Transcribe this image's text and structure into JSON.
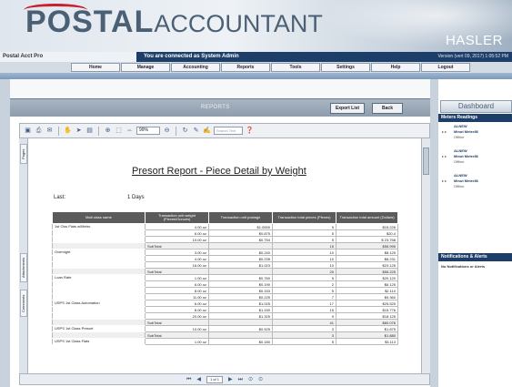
{
  "header": {
    "logo_postal": "POSTAL",
    "logo_accountant": "ACCOUNTANT",
    "brand": "HASLER"
  },
  "infobar": {
    "product_name": "Postal Acct Pro",
    "connected_msg": "You are connected as System Admin",
    "date_status": "Version (vert 09, 2017) 1:05:52 PM"
  },
  "nav": {
    "items": [
      "Home",
      "Manage",
      "Accounting",
      "Reports",
      "Tools",
      "Settings",
      "Help",
      "Logout"
    ]
  },
  "report_bar": {
    "title": "REPORTS",
    "export_label": "Export List",
    "back_label": "Back"
  },
  "toolbar": {
    "zoom": "99%",
    "search_placeholder": "Search Text"
  },
  "side_tabs": {
    "pages": "Pages",
    "attachments": "Attachments",
    "comments": "Comments"
  },
  "report": {
    "title": "Presort Report - Piece Detail by Weight",
    "last_label": "Last:",
    "last_value": "1 Days",
    "columns": [
      "Mail class name",
      "Transaction unit weight (Pieces/Ounces)",
      "Transaction unit postage",
      "Transaction total pieces (Pieces)",
      "Transaction total amount (Dollars)"
    ],
    "groups": [
      {
        "name": "1st Clss Flats w/Metro",
        "rows": [
          {
            "weight": "4.00 oz",
            "unit": "$1.0000",
            "pieces": "5",
            "amount": "$15.226"
          },
          {
            "weight": "6.00 oz",
            "unit": "$0.875",
            "pieces": "5",
            "amount": "$20.4"
          },
          {
            "weight": "10.00 oz",
            "unit": "$0.754",
            "pieces": "5",
            "amount": "$ 23.758"
          }
        ],
        "subtotal_pieces": "15",
        "subtotal_amount": "$55.995"
      },
      {
        "name": "Overnight",
        "rows": [
          {
            "weight": "3.00 oz",
            "unit": "$0.240",
            "pieces": "10",
            "amount": "$8.125"
          },
          {
            "weight": "4.00 oz",
            "unit": "$0.235",
            "pieces": "10",
            "amount": "$8.231"
          },
          {
            "weight": "16.00 oz",
            "unit": "$1.023",
            "pieces": "10",
            "amount": "$23.125"
          }
        ],
        "subtotal_pieces": "20",
        "subtotal_amount": "$55.225"
      },
      {
        "name": "Loan Rate",
        "rows": [
          {
            "weight": "1.00 oz",
            "unit": "$0.760",
            "pieces": "5",
            "amount": "$20.120"
          },
          {
            "weight": "6.00 oz",
            "unit": "$0.190",
            "pieces": "2",
            "amount": "$6.125"
          },
          {
            "weight": "8.00 oz",
            "unit": "$0.153",
            "pieces": "5",
            "amount": "$2.110"
          },
          {
            "weight": "11.00 oz",
            "unit": "$0.225",
            "pieces": "7",
            "amount": "$9.360"
          }
        ]
      },
      {
        "name": "USPS 1st Class Automation",
        "rows": [
          {
            "weight": "6.00 oz",
            "unit": "$1.025",
            "pieces": "17",
            "amount": "$25.525"
          },
          {
            "weight": "8.00 oz",
            "unit": "$1.150",
            "pieces": "15",
            "amount": "$15.776"
          },
          {
            "weight": "20.00 oz",
            "unit": "$1.325",
            "pieces": "9",
            "amount": "$18.125"
          }
        ],
        "subtotal_pieces": "41",
        "subtotal_amount": "$60.076"
      },
      {
        "name": "USPS 1st Class Presort",
        "rows": [
          {
            "weight": "10.00 oz",
            "unit": "$0.525",
            "pieces": "3",
            "amount": "$1.875"
          }
        ],
        "subtotal_pieces": "3",
        "subtotal_amount": "$1.880"
      },
      {
        "name": "USPS 1st Class Flats",
        "rows": [
          {
            "weight": "1.00 oz",
            "unit": "$0.180",
            "pieces": "5",
            "amount": "$3.113"
          }
        ]
      }
    ],
    "subtotal_label": "SubTotal"
  },
  "statusbar": {
    "page": "1 of 1"
  },
  "dashboard": {
    "title": "Dashboard",
    "meters_header": "Meters Readings",
    "meters": [
      {
        "id": "ALNEW",
        "location": "Minot Meter86",
        "status": "Offline"
      },
      {
        "id": "ALNEW",
        "location": "Minot Meter86",
        "status": "Offline"
      },
      {
        "id": "ALNEW",
        "location": "Minot Meter86",
        "status": "Offline"
      }
    ],
    "notifications_header": "Notifications & Alerts",
    "notifications_msg": "No Notifications or Alerts"
  }
}
